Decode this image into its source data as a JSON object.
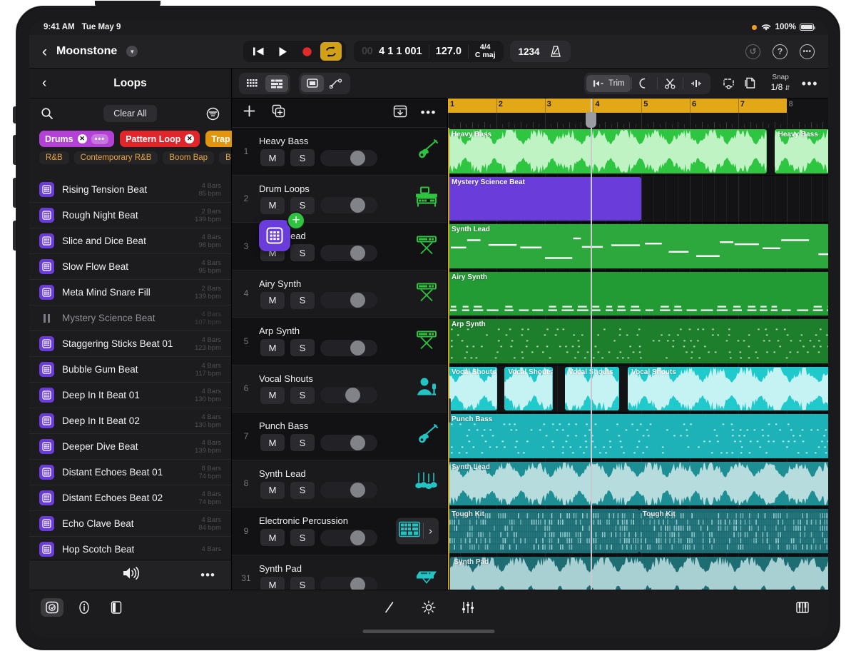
{
  "status_bar": {
    "time": "9:41 AM",
    "date": "Tue May 9",
    "battery": "100%",
    "wifi_icon": "wifi-icon",
    "recording_dot": "orange-dot"
  },
  "nav": {
    "back_icon": "chevron-left-icon",
    "project_title": "Moonstone",
    "disclosure_icon": "chevron-down-icon",
    "transport": {
      "rewind_icon": "rewind-to-start-icon",
      "play_icon": "play-icon",
      "record_icon": "record-icon",
      "cycle_icon": "cycle-loop-icon",
      "cycle_active_color": "#d2a017"
    },
    "lcd": {
      "position_dim": "00",
      "position": "4 1 1 001",
      "tempo": "127.0",
      "time_signature": "4/4",
      "key": "C maj"
    },
    "count_in": "1234",
    "metronome_icon": "metronome-icon",
    "undo_icon": "undo-icon",
    "help_icon": "help-question-icon",
    "more_icon": "more-ellipsis-icon"
  },
  "browser": {
    "back_icon": "chevron-left-icon",
    "title": "Loops",
    "search_icon": "search-icon",
    "clear_all": "Clear All",
    "filter_icon": "filter-icon",
    "active_tags": [
      {
        "label": "Drums",
        "color": "#b341d6",
        "has_more": true
      },
      {
        "label": "Pattern Loop",
        "color": "#e0252b",
        "has_more": false
      },
      {
        "label": "Trap",
        "color": "#e2960f",
        "has_more": false
      }
    ],
    "suggested_tags": [
      "R&B",
      "Contemporary R&B",
      "Boom Bap",
      "Bass M"
    ],
    "loops": [
      {
        "name": "Rising Tension Beat",
        "bars": "4 Bars",
        "bpm": "85 bpm",
        "playing": false
      },
      {
        "name": "Rough Night Beat",
        "bars": "2 Bars",
        "bpm": "139 bpm",
        "playing": false
      },
      {
        "name": "Slice and Dice Beat",
        "bars": "4 Bars",
        "bpm": "98 bpm",
        "playing": false
      },
      {
        "name": "Slow Flow Beat",
        "bars": "4 Bars",
        "bpm": "95 bpm",
        "playing": false
      },
      {
        "name": "Meta Mind Snare Fill",
        "bars": "2 Bars",
        "bpm": "139 bpm",
        "playing": false
      },
      {
        "name": "Mystery Science Beat",
        "bars": "4 Bars",
        "bpm": "107 bpm",
        "playing": true
      },
      {
        "name": "Staggering Sticks Beat 01",
        "bars": "4 Bars",
        "bpm": "123 bpm",
        "playing": false
      },
      {
        "name": "Bubble Gum Beat",
        "bars": "4 Bars",
        "bpm": "117 bpm",
        "playing": false
      },
      {
        "name": "Deep In It Beat 01",
        "bars": "4 Bars",
        "bpm": "130 bpm",
        "playing": false
      },
      {
        "name": "Deep In It Beat 02",
        "bars": "4 Bars",
        "bpm": "130 bpm",
        "playing": false
      },
      {
        "name": "Deeper Dive Beat",
        "bars": "4 Bars",
        "bpm": "139 bpm",
        "playing": false
      },
      {
        "name": "Distant Echoes Beat 01",
        "bars": "8 Bars",
        "bpm": "74 bpm",
        "playing": false
      },
      {
        "name": "Distant Echoes Beat 02",
        "bars": "4 Bars",
        "bpm": "74 bpm",
        "playing": false
      },
      {
        "name": "Echo Clave Beat",
        "bars": "4 Bars",
        "bpm": "84 bpm",
        "playing": false
      },
      {
        "name": "Hop Scotch Beat",
        "bars": "4 Bars",
        "bpm": "",
        "playing": false
      }
    ],
    "footer": {
      "speaker_icon": "speaker-volume-icon",
      "more_icon": "more-ellipsis-icon"
    }
  },
  "track_toolbar": {
    "view_buttons": [
      {
        "icon": "grid-cells-icon",
        "active": false
      },
      {
        "icon": "track-list-icon",
        "active": true
      }
    ],
    "shape_buttons": [
      {
        "icon": "region-rectangle-icon",
        "active": true
      },
      {
        "icon": "automation-curve-icon",
        "active": false
      }
    ],
    "edit_buttons": [
      {
        "icon": "trim-icon",
        "label": "Trim",
        "active": true
      },
      {
        "icon": "loop-arc-icon",
        "label": "",
        "active": false
      },
      {
        "icon": "scissors-icon",
        "label": "",
        "active": false
      },
      {
        "icon": "fade-icon",
        "label": "",
        "active": false
      }
    ],
    "extra_buttons": [
      {
        "icon": "select-lasso-icon"
      },
      {
        "icon": "duplicate-copy-icon"
      }
    ],
    "snap_label": "Snap",
    "snap_value": "1/8",
    "snap_stepper_icon": "chevron-updown-icon",
    "more_icon": "more-ellipsis-icon"
  },
  "track_header_bar": {
    "add_track_icon": "plus-icon",
    "duplicate_track_icon": "duplicate-track-icon",
    "collapse_icon": "collapse-tracks-icon",
    "more_icon": "more-ellipsis-icon"
  },
  "tracks": [
    {
      "num": "1",
      "name": "Heavy Bass",
      "mute": "M",
      "solo": "S",
      "volume": 0.73,
      "instrument_icon": "bass-guitar-icon",
      "color": "#2fc23f",
      "chevron": false
    },
    {
      "num": "2",
      "name": "Drum Loops",
      "mute": "M",
      "solo": "S",
      "volume": 0.73,
      "instrument_icon": "drum-machine-icon",
      "color": "#2fc23f",
      "chevron": false
    },
    {
      "num": "3",
      "name": "Synth Lead",
      "mute": "M",
      "solo": "S",
      "volume": 0.73,
      "instrument_icon": "keyboard-stand-icon",
      "color": "#2fc23f",
      "chevron": false
    },
    {
      "num": "4",
      "name": "Airy Synth",
      "mute": "M",
      "solo": "S",
      "volume": 0.73,
      "instrument_icon": "keyboard-stand-icon",
      "color": "#2fc23f",
      "chevron": false
    },
    {
      "num": "5",
      "name": "Arp Synth",
      "mute": "M",
      "solo": "S",
      "volume": 0.73,
      "instrument_icon": "keyboard-stand-icon",
      "color": "#2fc23f",
      "chevron": false
    },
    {
      "num": "6",
      "name": "Vocal Shouts",
      "mute": "M",
      "solo": "S",
      "volume": 0.6,
      "instrument_icon": "vocalist-mic-icon",
      "color": "#23c4c4",
      "chevron": false
    },
    {
      "num": "7",
      "name": "Punch Bass",
      "mute": "M",
      "solo": "S",
      "volume": 0.73,
      "instrument_icon": "bass-guitar-icon",
      "color": "#23c4c4",
      "chevron": false
    },
    {
      "num": "8",
      "name": "Synth Lead",
      "mute": "M",
      "solo": "S",
      "volume": 0.73,
      "instrument_icon": "strings-icon",
      "color": "#23c4c4",
      "chevron": false
    },
    {
      "num": "9",
      "name": "Electronic Percussion",
      "mute": "M",
      "solo": "S",
      "volume": 0.73,
      "instrument_icon": "drum-pads-icon",
      "color": "#23c4c4",
      "chevron": true
    },
    {
      "num": "31",
      "name": "Synth Pad",
      "mute": "M",
      "solo": "S",
      "volume": 0.73,
      "instrument_icon": "keyboard-slim-icon",
      "color": "#23c4c4",
      "chevron": false
    }
  ],
  "timeline": {
    "bars": [
      "1",
      "2",
      "3",
      "4",
      "5",
      "6",
      "7",
      "8"
    ],
    "cycle_start_bar": 1,
    "cycle_end_bar": 8,
    "cycle_color": "#e2a817",
    "playhead_bar": 3.95,
    "lanes": [
      {
        "track": "Heavy Bass",
        "type": "audio",
        "color": "#2ec541",
        "wave": "#bff3c4",
        "regions": [
          {
            "name": "Heavy Bass",
            "start": 1.0,
            "end": 7.6
          },
          {
            "name": "Heavy Bass",
            "start": 7.75,
            "end": 9.1
          }
        ]
      },
      {
        "track": "Drum Loops",
        "type": "midi-drop",
        "color": "#6a3ddb",
        "wave": "#8f6ce8",
        "regions": [
          {
            "name": "Mystery Science Beat",
            "start": 1.0,
            "end": 5.0
          }
        ]
      },
      {
        "track": "Synth Lead",
        "type": "midi-notes",
        "color": "#2ca83c",
        "wave": "#ffffff",
        "regions": [
          {
            "name": "Synth Lead",
            "start": 1.0,
            "end": 9.1
          }
        ]
      },
      {
        "track": "Airy Synth",
        "type": "midi-low",
        "color": "#229b34",
        "wave": "#ffffff",
        "regions": [
          {
            "name": "Airy Synth",
            "start": 1.0,
            "end": 9.1
          }
        ]
      },
      {
        "track": "Arp Synth",
        "type": "midi-dots",
        "color": "#1d7f2c",
        "wave": "#cfeccf",
        "regions": [
          {
            "name": "Arp Synth",
            "start": 1.0,
            "end": 9.1
          }
        ]
      },
      {
        "track": "Vocal Shouts",
        "type": "audio",
        "color": "#1fc9cc",
        "wave": "#c5f3f4",
        "regions": [
          {
            "name": "Vocal Shouts",
            "start": 1.0,
            "end": 2.02
          },
          {
            "name": "Vocal Shouts",
            "start": 2.17,
            "end": 3.17
          },
          {
            "name": "Vocal Shouts",
            "start": 3.42,
            "end": 4.54
          },
          {
            "name": "Vocal Shouts",
            "start": 4.72,
            "end": 9.1
          }
        ]
      },
      {
        "track": "Punch Bass",
        "type": "midi-dots",
        "color": "#1cb2b8",
        "wave": "#ddf7f8",
        "regions": [
          {
            "name": "Punch Bass",
            "start": 1.0,
            "end": 9.1
          }
        ]
      },
      {
        "track": "Synth Lead",
        "type": "audio",
        "color": "#1d8e93",
        "wave": "#b7dcdd",
        "regions": [
          {
            "name": "Synth Lead",
            "start": 1.0,
            "end": 9.1
          }
        ]
      },
      {
        "track": "Electronic Percussion",
        "type": "midi-grid",
        "color": "#1c6c74",
        "wave": "#9fd4d8",
        "regions": [
          {
            "name": "Tough Kit",
            "start": 1.0,
            "end": 4.95
          },
          {
            "name": "Tough Kit",
            "start": 4.95,
            "end": 9.1
          }
        ]
      },
      {
        "track": "Synth Pad",
        "type": "audio",
        "color": "#1d6d73",
        "wave": "#a8cfd2",
        "regions": [
          {
            "name": "Synth Pad",
            "start": 1.05,
            "end": 9.1
          }
        ]
      }
    ],
    "drag": {
      "ghost_icon": "loop-pattern-icon",
      "badge": "+",
      "badge_color": "#2fc23f"
    }
  },
  "bottom_bar": {
    "left_buttons": [
      {
        "icon": "loop-browser-icon",
        "active": true
      },
      {
        "icon": "info-icon",
        "active": false
      },
      {
        "icon": "panel-toggle-icon",
        "active": false
      }
    ],
    "mid_buttons": [
      {
        "icon": "pencil-edit-icon"
      },
      {
        "icon": "brightness-fx-icon"
      },
      {
        "icon": "mixer-faders-icon"
      }
    ],
    "right_button": {
      "icon": "piano-keys-icon"
    }
  }
}
